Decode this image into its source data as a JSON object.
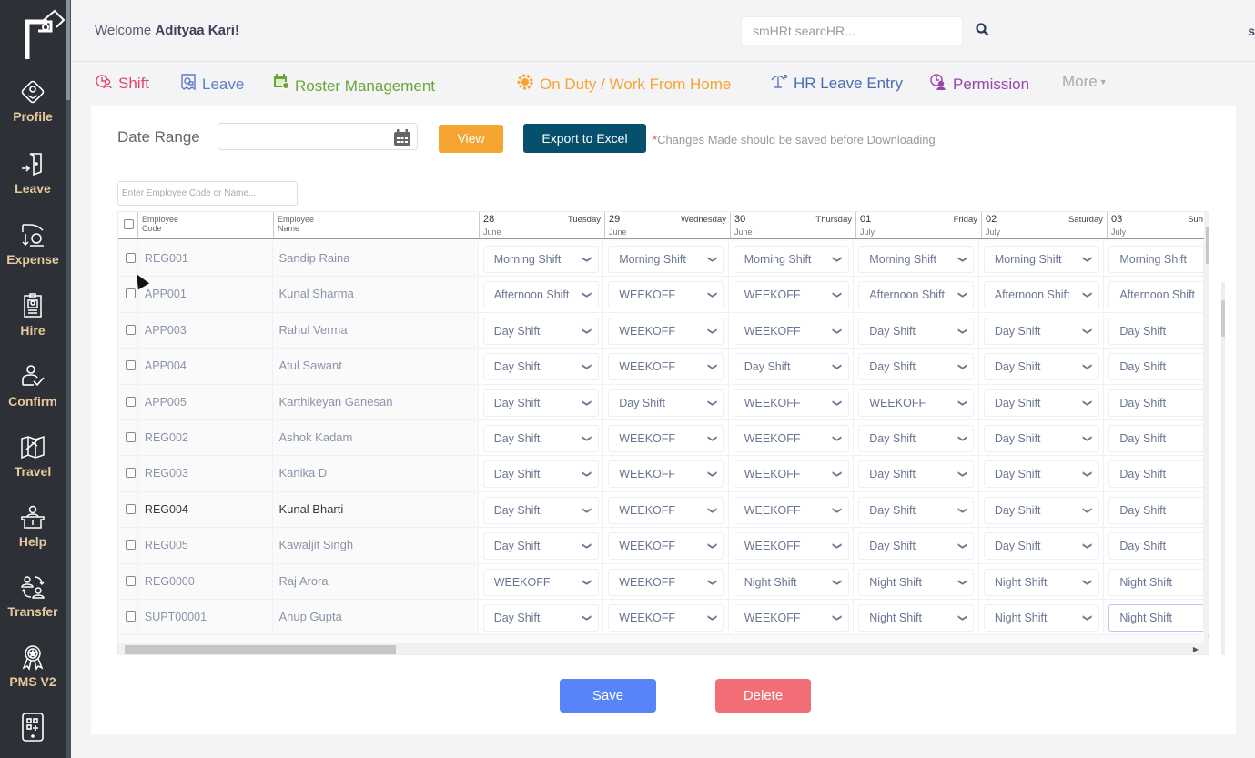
{
  "sidebar": {
    "items": [
      {
        "label": "Profile",
        "icon": "profile-icon"
      },
      {
        "label": "Leave",
        "icon": "leave-door-icon"
      },
      {
        "label": "Expense",
        "icon": "expense-icon"
      },
      {
        "label": "Hire",
        "icon": "hire-icon"
      },
      {
        "label": "Confirm",
        "icon": "confirm-icon"
      },
      {
        "label": "Travel",
        "icon": "travel-icon"
      },
      {
        "label": "Help",
        "icon": "help-icon"
      },
      {
        "label": "Transfer",
        "icon": "transfer-icon"
      },
      {
        "label": "PMS V2",
        "icon": "pms-icon"
      }
    ]
  },
  "header": {
    "welcome_prefix": "Welcome",
    "user_name": "Adityaa Kari!",
    "search_placeholder": "smHRt searcHR...",
    "user_initial": "s"
  },
  "tabs": [
    {
      "label": "Shift",
      "color": "#e0466b",
      "icon": "shift-icon"
    },
    {
      "label": "Leave",
      "color": "#5b7fc7",
      "icon": "leave-icon"
    },
    {
      "label": "Roster Management",
      "color": "#6aa636",
      "icon": "roster-icon"
    },
    {
      "label": "On Duty / Work From Home",
      "color": "#f5a431",
      "icon": "on-duty-icon"
    },
    {
      "label": "HR Leave Entry",
      "color": "#4a6cb5",
      "icon": "hr-leave-icon"
    },
    {
      "label": "Permission",
      "color": "#9747a8",
      "icon": "permission-icon"
    },
    {
      "label": "More",
      "color": "#aaaaaa",
      "icon": "caret-down-icon"
    }
  ],
  "form": {
    "date_range_label": "Date Range",
    "date_range_value": "",
    "view_label": "View",
    "export_label": "Export to Excel",
    "note_star": "*",
    "note_text": "Changes Made should be saved before Downloading",
    "employee_search_placeholder": "Enter Employee Code or Name..."
  },
  "grid": {
    "columns": {
      "code": "Employee\nCode",
      "code_l1": "Employee",
      "code_l2": "Code",
      "name_l1": "Employee",
      "name_l2": "Name"
    },
    "days": [
      {
        "date": "28",
        "weekday": "Tuesday",
        "month": "June"
      },
      {
        "date": "29",
        "weekday": "Wednesday",
        "month": "June"
      },
      {
        "date": "30",
        "weekday": "Thursday",
        "month": "June"
      },
      {
        "date": "01",
        "weekday": "Friday",
        "month": "July"
      },
      {
        "date": "02",
        "weekday": "Saturday",
        "month": "July"
      },
      {
        "date": "03",
        "weekday": "Sun",
        "month": "July"
      }
    ],
    "rows": [
      {
        "code": "REG001",
        "name": "Sandip Raina",
        "shifts": [
          "Morning Shift",
          "Morning Shift",
          "Morning Shift",
          "Morning Shift",
          "Morning Shift",
          "Morning Shift"
        ]
      },
      {
        "code": "APP001",
        "name": "Kunal Sharma",
        "shifts": [
          "Afternoon Shift",
          "WEEKOFF",
          "WEEKOFF",
          "Afternoon Shift",
          "Afternoon Shift",
          "Afternoon Shift"
        ]
      },
      {
        "code": "APP003",
        "name": "Rahul Verma",
        "shifts": [
          "Day Shift",
          "WEEKOFF",
          "WEEKOFF",
          "Day Shift",
          "Day Shift",
          "Day Shift"
        ]
      },
      {
        "code": "APP004",
        "name": "Atul Sawant",
        "shifts": [
          "Day Shift",
          "WEEKOFF",
          "Day Shift",
          "Day Shift",
          "Day Shift",
          "Day Shift"
        ]
      },
      {
        "code": "APP005",
        "name": "Karthikeyan Ganesan",
        "shifts": [
          "Day Shift",
          "Day Shift",
          "WEEKOFF",
          "WEEKOFF",
          "Day Shift",
          "Day Shift"
        ]
      },
      {
        "code": "REG002",
        "name": "Ashok Kadam",
        "shifts": [
          "Day Shift",
          "WEEKOFF",
          "WEEKOFF",
          "Day Shift",
          "Day Shift",
          "Day Shift"
        ]
      },
      {
        "code": "REG003",
        "name": "Kanika D",
        "shifts": [
          "Day Shift",
          "WEEKOFF",
          "WEEKOFF",
          "Day Shift",
          "Day Shift",
          "Day Shift"
        ]
      },
      {
        "code": "REG004",
        "name": "Kunal Bharti",
        "shifts": [
          "Day Shift",
          "WEEKOFF",
          "WEEKOFF",
          "Day Shift",
          "Day Shift",
          "Day Shift"
        ]
      },
      {
        "code": "REG005",
        "name": "Kawaljit Singh",
        "shifts": [
          "Day Shift",
          "WEEKOFF",
          "WEEKOFF",
          "Day Shift",
          "Day Shift",
          "Day Shift"
        ]
      },
      {
        "code": "REG0000",
        "name": "Raj Arora",
        "shifts": [
          "WEEKOFF",
          "WEEKOFF",
          "Night Shift",
          "Night Shift",
          "Night Shift",
          "Night Shift"
        ]
      },
      {
        "code": "SUPT00001",
        "name": "Anup Gupta",
        "shifts": [
          "Day Shift",
          "WEEKOFF",
          "WEEKOFF",
          "Night Shift",
          "Night Shift",
          "Night Shift"
        ]
      }
    ]
  },
  "actions": {
    "save_label": "Save",
    "delete_label": "Delete"
  }
}
